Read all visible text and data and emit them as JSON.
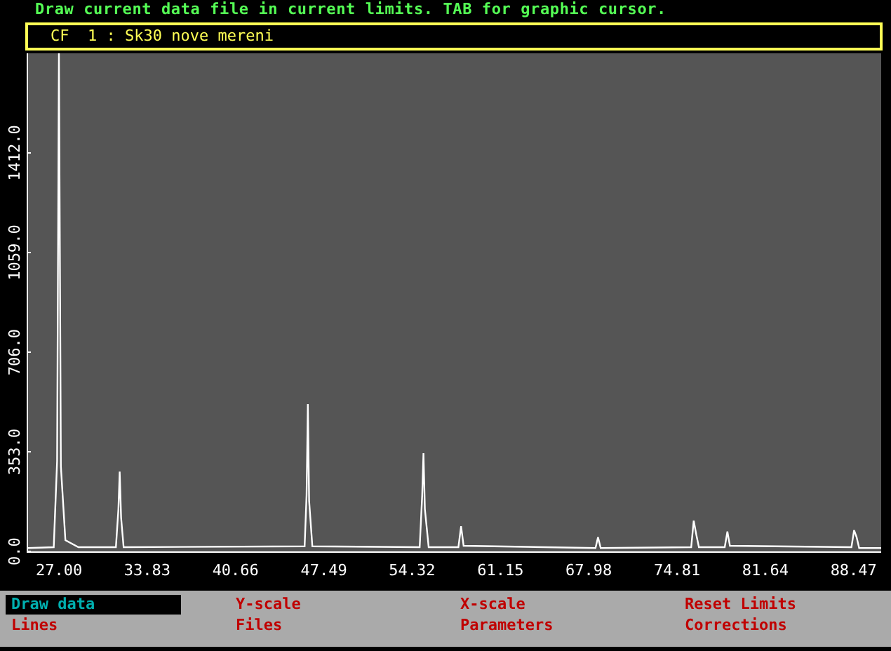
{
  "status_line": "Draw current data file in current limits.  TAB for graphic cursor.",
  "current_file": "CF  1 : Sk30 nove mereni",
  "chart_data": {
    "type": "line",
    "xlim": [
      24.5,
      90.6
    ],
    "ylim": [
      0,
      1765
    ],
    "xticks": [
      {
        "value": 27.0,
        "label": "27.00"
      },
      {
        "value": 33.83,
        "label": "33.83"
      },
      {
        "value": 40.66,
        "label": "40.66"
      },
      {
        "value": 47.49,
        "label": "47.49"
      },
      {
        "value": 54.32,
        "label": "54.32"
      },
      {
        "value": 61.15,
        "label": "61.15"
      },
      {
        "value": 67.98,
        "label": "67.98"
      },
      {
        "value": 74.81,
        "label": "74.81"
      },
      {
        "value": 81.64,
        "label": "81.64"
      },
      {
        "value": 88.47,
        "label": "88.47"
      }
    ],
    "yticks": [
      {
        "value": 0,
        "label": "0.0"
      },
      {
        "value": 353,
        "label": "353.0"
      },
      {
        "value": 706,
        "label": "706.0"
      },
      {
        "value": 1059,
        "label": "1059.0"
      },
      {
        "value": 1412,
        "label": "1412.0"
      }
    ],
    "x": [
      24.6,
      26.6,
      26.85,
      27.0,
      27.15,
      27.5,
      28.5,
      31.4,
      31.6,
      31.7,
      31.8,
      32.0,
      46.0,
      46.15,
      46.25,
      46.35,
      46.6,
      54.9,
      55.1,
      55.2,
      55.3,
      55.6,
      57.9,
      58.1,
      58.3,
      68.5,
      68.7,
      68.9,
      75.9,
      76.1,
      76.3,
      76.5,
      78.5,
      78.7,
      78.9,
      88.3,
      88.5,
      88.7,
      88.9,
      90.6
    ],
    "series": [
      {
        "color": "#ffffff",
        "values": [
          12,
          15,
          320,
          1765,
          300,
          40,
          15,
          15,
          150,
          283,
          120,
          15,
          18,
          200,
          522,
          180,
          18,
          15,
          200,
          348,
          150,
          15,
          15,
          89,
          20,
          12,
          50,
          12,
          15,
          109,
          60,
          15,
          15,
          70,
          20,
          15,
          75,
          50,
          12,
          12
        ]
      }
    ]
  },
  "menu": [
    {
      "label": "Draw data",
      "selected": true
    },
    {
      "label": "Y-scale",
      "selected": false
    },
    {
      "label": "X-scale",
      "selected": false
    },
    {
      "label": "Reset Limits",
      "selected": false
    },
    {
      "label": "Lines",
      "selected": false
    },
    {
      "label": "Files",
      "selected": false
    },
    {
      "label": "Parameters",
      "selected": false
    },
    {
      "label": "Corrections",
      "selected": false
    }
  ]
}
